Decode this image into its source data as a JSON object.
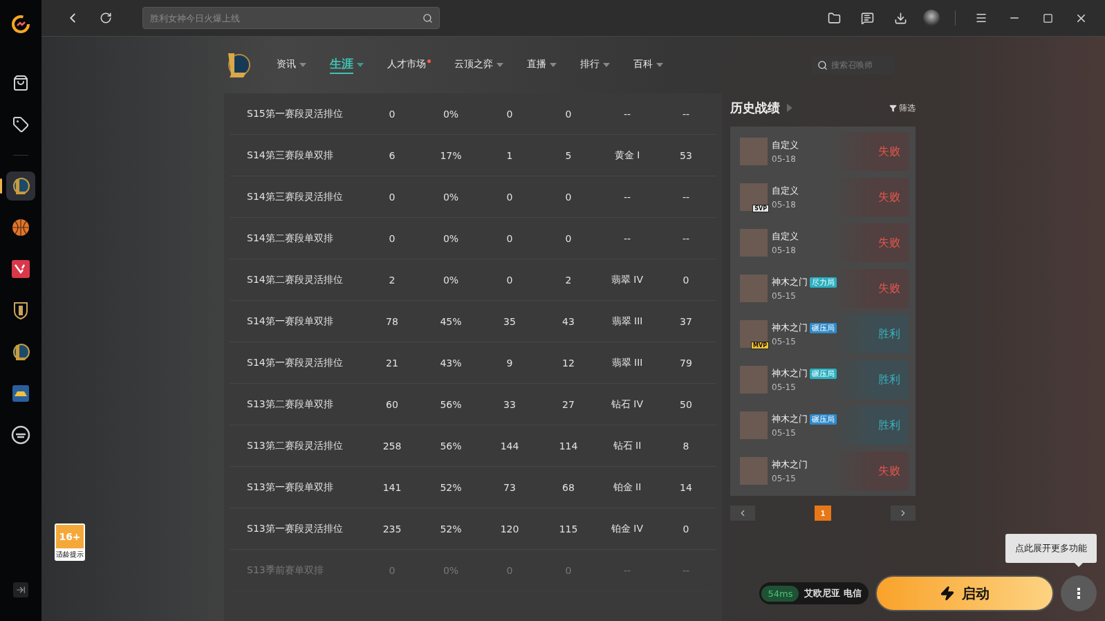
{
  "search": {
    "placeholder": "胜利女神今日火爆上线"
  },
  "sidebar": {
    "items": [
      {
        "kind": "store",
        "selected": false
      },
      {
        "kind": "tag",
        "selected": false
      },
      {
        "kind": "lol",
        "selected": true
      },
      {
        "kind": "basketball",
        "selected": false
      },
      {
        "kind": "valorant",
        "selected": false
      },
      {
        "kind": "shield",
        "selected": false
      },
      {
        "kind": "lol",
        "selected": false
      },
      {
        "kind": "car",
        "selected": false
      },
      {
        "kind": "cf",
        "selected": false
      }
    ]
  },
  "age_badge": {
    "rating": "16+",
    "caption": "适龄提示"
  },
  "nav": {
    "tabs": [
      {
        "label": "资讯",
        "selected": false,
        "dot": false,
        "caret": true
      },
      {
        "label": "生涯",
        "selected": true,
        "dot": false,
        "caret": true
      },
      {
        "label": "人才市场",
        "selected": false,
        "dot": true,
        "caret": false
      },
      {
        "label": "云顶之弈",
        "selected": false,
        "dot": false,
        "caret": true
      },
      {
        "label": "直播",
        "selected": false,
        "dot": false,
        "caret": true
      },
      {
        "label": "排行",
        "selected": false,
        "dot": false,
        "caret": true
      },
      {
        "label": "百科",
        "selected": false,
        "dot": false,
        "caret": true
      }
    ],
    "search_placeholder": "搜索召唤师"
  },
  "table": {
    "rows": [
      {
        "cells": [
          "S15第一赛段灵活排位",
          "0",
          "0%",
          "0",
          "0",
          "--",
          "--"
        ],
        "dimmed": false
      },
      {
        "cells": [
          "S14第三赛段单双排",
          "6",
          "17%",
          "1",
          "5",
          "黄金 I",
          "53"
        ],
        "dimmed": false
      },
      {
        "cells": [
          "S14第三赛段灵活排位",
          "0",
          "0%",
          "0",
          "0",
          "--",
          "--"
        ],
        "dimmed": false
      },
      {
        "cells": [
          "S14第二赛段单双排",
          "0",
          "0%",
          "0",
          "0",
          "--",
          "--"
        ],
        "dimmed": false
      },
      {
        "cells": [
          "S14第二赛段灵活排位",
          "2",
          "0%",
          "0",
          "2",
          "翡翠 IV",
          "0"
        ],
        "dimmed": false
      },
      {
        "cells": [
          "S14第一赛段单双排",
          "78",
          "45%",
          "35",
          "43",
          "翡翠 III",
          "37"
        ],
        "dimmed": false
      },
      {
        "cells": [
          "S14第一赛段灵活排位",
          "21",
          "43%",
          "9",
          "12",
          "翡翠 III",
          "79"
        ],
        "dimmed": false
      },
      {
        "cells": [
          "S13第二赛段单双排",
          "60",
          "56%",
          "33",
          "27",
          "钻石 IV",
          "50"
        ],
        "dimmed": false
      },
      {
        "cells": [
          "S13第二赛段灵活排位",
          "258",
          "56%",
          "144",
          "114",
          "钻石 II",
          "8"
        ],
        "dimmed": false
      },
      {
        "cells": [
          "S13第一赛段单双排",
          "141",
          "52%",
          "73",
          "68",
          "铂金 II",
          "14"
        ],
        "dimmed": false
      },
      {
        "cells": [
          "S13第一赛段灵活排位",
          "235",
          "52%",
          "120",
          "115",
          "铂金 IV",
          "0"
        ],
        "dimmed": false
      },
      {
        "cells": [
          "S13季前赛单双排",
          "0",
          "0%",
          "0",
          "0",
          "--",
          "--"
        ],
        "dimmed": true
      }
    ]
  },
  "history": {
    "title": "历史战绩",
    "filter": "筛选",
    "matches": [
      {
        "mode": "自定义",
        "date": "05-18",
        "result": "失败",
        "kind": "loss"
      },
      {
        "mode": "自定义",
        "date": "05-18",
        "result": "失败",
        "kind": "loss",
        "award": "SVP"
      },
      {
        "mode": "自定义",
        "date": "05-18",
        "result": "失败",
        "kind": "loss"
      },
      {
        "mode": "神木之门",
        "tag": "尽力局",
        "date": "05-15",
        "result": "失败",
        "kind": "loss"
      },
      {
        "mode": "神木之门",
        "tag": "碾压局",
        "date": "05-15",
        "result": "胜利",
        "kind": "win",
        "award": "MVP"
      },
      {
        "mode": "神木之门",
        "tag": "碾压局",
        "date": "05-15",
        "result": "胜利",
        "kind": "win"
      },
      {
        "mode": "神木之门",
        "tag": "碾压局",
        "date": "05-15",
        "result": "胜利",
        "kind": "win"
      },
      {
        "mode": "神木之门",
        "date": "05-15",
        "result": "失败",
        "kind": "loss"
      }
    ],
    "pages": [
      {
        "label": "1",
        "selected": true
      }
    ]
  },
  "launch": {
    "ping": "54ms",
    "server": "艾欧尼亚 电信",
    "button": "启动",
    "tooltip": "点此展开更多功能"
  }
}
